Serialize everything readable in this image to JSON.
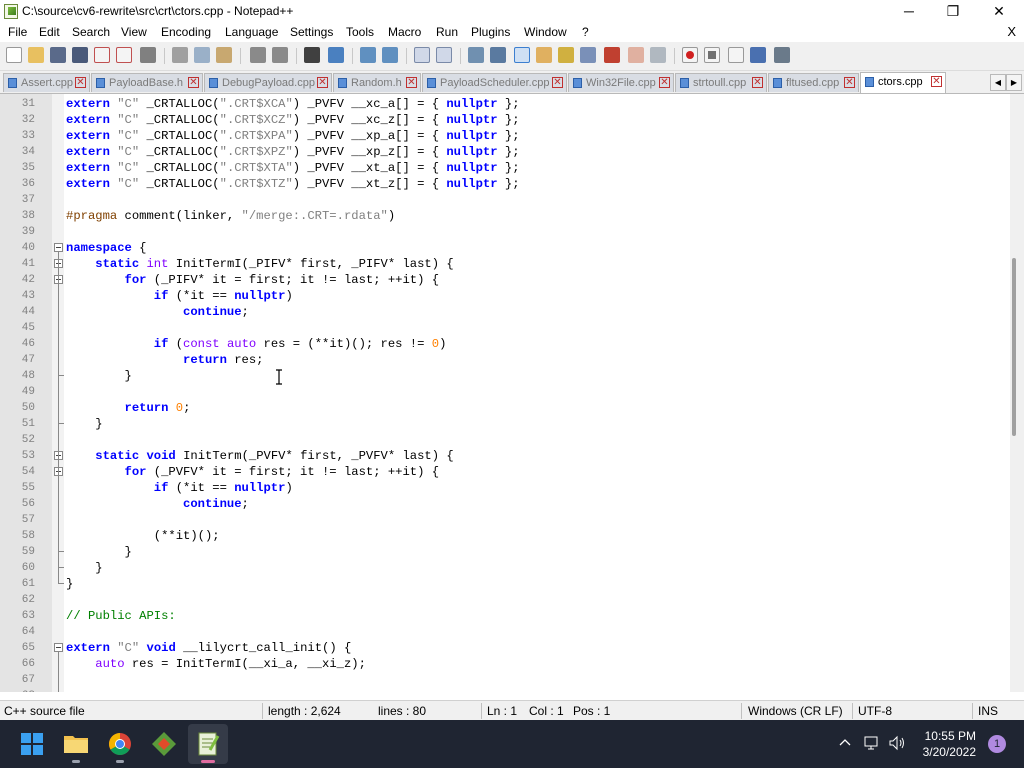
{
  "window": {
    "title": "C:\\source\\cv6-rewrite\\src\\crt\\ctors.cpp - Notepad++",
    "minimize_glyph": "─",
    "maximize_glyph": "❐",
    "close_glyph": "✕"
  },
  "menu": {
    "items": [
      "File",
      "Edit",
      "Search",
      "View",
      "Encoding",
      "Language",
      "Settings",
      "Tools",
      "Macro",
      "Run",
      "Plugins",
      "Window",
      "?"
    ],
    "close_glyph": "X"
  },
  "toolbar": {
    "buttons": [
      "new-file-icon",
      "open-file-icon",
      "save-icon",
      "save-all-icon",
      "close-icon",
      "close-all-icon",
      "print-icon",
      "cut-icon",
      "copy-icon",
      "paste-icon",
      "undo-icon",
      "redo-icon",
      "find-icon",
      "replace-icon",
      "zoom-in-icon",
      "zoom-out-icon",
      "sync-vertical-icon",
      "sync-horizontal-icon",
      "word-wrap-icon",
      "show-all-chars-icon",
      "indent-guide-icon",
      "udl-icon",
      "doc-map-icon",
      "function-list-icon",
      "folder-as-workspace-icon",
      "monitoring-icon",
      "record-macro-icon",
      "stop-macro-icon",
      "play-macro-icon",
      "run-macro-multiple-icon",
      "save-macro-icon"
    ]
  },
  "tabs": [
    {
      "label": "Assert.cpp",
      "active": false
    },
    {
      "label": "PayloadBase.h",
      "active": false
    },
    {
      "label": "DebugPayload.cpp",
      "active": false
    },
    {
      "label": "Random.h",
      "active": false
    },
    {
      "label": "PayloadScheduler.cpp",
      "active": false
    },
    {
      "label": "Win32File.cpp",
      "active": false
    },
    {
      "label": "strtoull.cpp",
      "active": false
    },
    {
      "label": "fltused.cpp",
      "active": false
    },
    {
      "label": "ctors.cpp",
      "active": true
    }
  ],
  "tab_nav": {
    "left": "◀",
    "right": "▶"
  },
  "editor": {
    "lines": [
      {
        "n": "31",
        "t": "extern \"C\" _CRTALLOC(\".CRT$XCA\") _PVFV __xc_a[] = { nullptr };"
      },
      {
        "n": "32",
        "t": "extern \"C\" _CRTALLOC(\".CRT$XCZ\") _PVFV __xc_z[] = { nullptr };"
      },
      {
        "n": "33",
        "t": "extern \"C\" _CRTALLOC(\".CRT$XPA\") _PVFV __xp_a[] = { nullptr };"
      },
      {
        "n": "34",
        "t": "extern \"C\" _CRTALLOC(\".CRT$XPZ\") _PVFV __xp_z[] = { nullptr };"
      },
      {
        "n": "35",
        "t": "extern \"C\" _CRTALLOC(\".CRT$XTA\") _PVFV __xt_a[] = { nullptr };"
      },
      {
        "n": "36",
        "t": "extern \"C\" _CRTALLOC(\".CRT$XTZ\") _PVFV __xt_z[] = { nullptr };"
      },
      {
        "n": "37",
        "t": ""
      },
      {
        "n": "38",
        "t": "#pragma comment(linker, \"/merge:.CRT=.rdata\")"
      },
      {
        "n": "39",
        "t": ""
      },
      {
        "n": "40",
        "t": "namespace {"
      },
      {
        "n": "41",
        "t": "    static int InitTermI(_PIFV* first, _PIFV* last) {"
      },
      {
        "n": "42",
        "t": "        for (_PIFV* it = first; it != last; ++it) {"
      },
      {
        "n": "43",
        "t": "            if (*it == nullptr)"
      },
      {
        "n": "44",
        "t": "                continue;"
      },
      {
        "n": "45",
        "t": ""
      },
      {
        "n": "46",
        "t": "            if (const auto res = (**it)(); res != 0)"
      },
      {
        "n": "47",
        "t": "                return res;"
      },
      {
        "n": "48",
        "t": "        }"
      },
      {
        "n": "49",
        "t": ""
      },
      {
        "n": "50",
        "t": "        return 0;"
      },
      {
        "n": "51",
        "t": "    }"
      },
      {
        "n": "52",
        "t": ""
      },
      {
        "n": "53",
        "t": "    static void InitTerm(_PVFV* first, _PVFV* last) {"
      },
      {
        "n": "54",
        "t": "        for (_PVFV* it = first; it != last; ++it) {"
      },
      {
        "n": "55",
        "t": "            if (*it == nullptr)"
      },
      {
        "n": "56",
        "t": "                continue;"
      },
      {
        "n": "57",
        "t": ""
      },
      {
        "n": "58",
        "t": "            (**it)();"
      },
      {
        "n": "59",
        "t": "        }"
      },
      {
        "n": "60",
        "t": "    }"
      },
      {
        "n": "61",
        "t": "}"
      },
      {
        "n": "62",
        "t": ""
      },
      {
        "n": "63",
        "t": "// Public APIs:"
      },
      {
        "n": "64",
        "t": ""
      },
      {
        "n": "65",
        "t": "extern \"C\" void __lilycrt_call_init() {"
      },
      {
        "n": "66",
        "t": "    auto res = InitTermI(__xi_a, __xi_z);"
      },
      {
        "n": "67",
        "t": ""
      },
      {
        "n": "68",
        "t": ""
      }
    ]
  },
  "statusbar": {
    "file_type": "C++ source file",
    "length": "length : 2,624",
    "lines": "lines : 80",
    "ln": "Ln : 1",
    "col": "Col : 1",
    "pos": "Pos : 1",
    "eol": "Windows (CR LF)",
    "encoding": "UTF-8",
    "mode": "INS"
  },
  "taskbar": {
    "apps": [
      "windows-start-icon",
      "file-explorer-icon",
      "chrome-icon",
      "git-gui-icon",
      "notepad-plus-plus-icon"
    ],
    "time": "10:55 PM",
    "date": "3/20/2022",
    "notification_count": "1"
  },
  "colors": {
    "keyword": "#0000ff",
    "type_keyword": "#8000ff",
    "string": "#808080",
    "number": "#ff8000",
    "comment": "#008000",
    "preprocessor": "#804000",
    "taskbar": "#1f2532"
  }
}
